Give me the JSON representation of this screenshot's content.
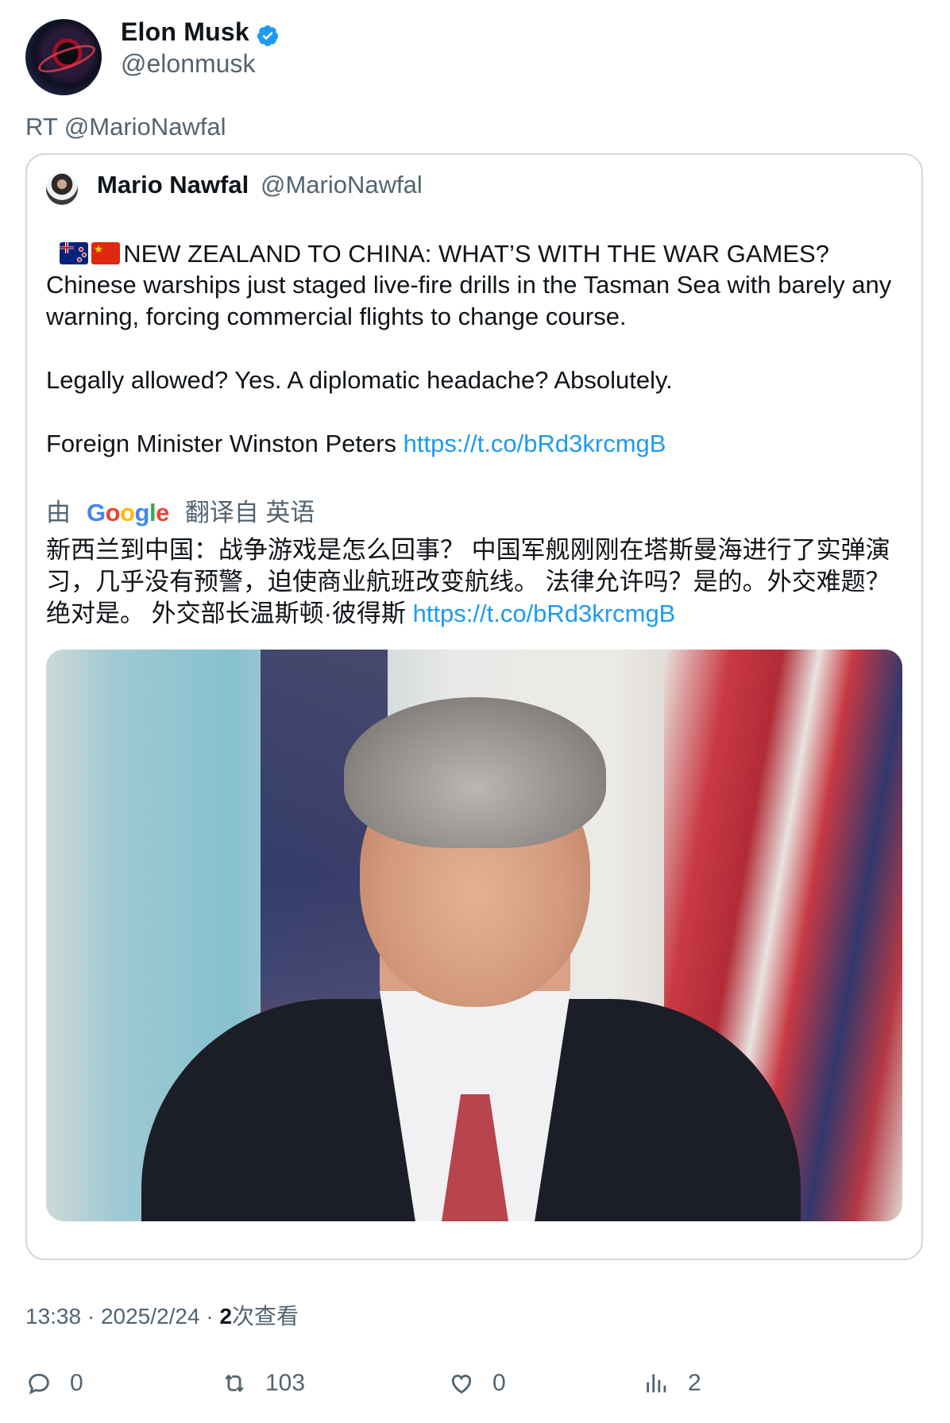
{
  "author": {
    "name": "Elon Musk",
    "handle": "@elonmusk",
    "verified": true
  },
  "retweet_label": "RT @MarioNawfal",
  "quoted": {
    "name": "Mario Nawfal",
    "handle": "@MarioNawfal",
    "headline": "NEW ZEALAND TO CHINA: WHAT’S WITH THE WAR GAMES?",
    "para1": "Chinese warships just staged live-fire drills in the Tasman Sea with barely any warning, forcing commercial flights to change course.",
    "para2": "Legally allowed? Yes. A diplomatic headache? Absolutely.",
    "para3_text": "Foreign Minister Winston Peters ",
    "para3_link": "https://t.co/bRd3krcmgB",
    "translation": {
      "by": "由",
      "google": "Google",
      "from": "翻译自 英语",
      "text": "新西兰到中国：战争游戏是怎么回事？ 中国军舰刚刚在塔斯曼海进行了实弹演习，几乎没有预警，迫使商业航班改变航线。 法律允许吗？是的。外交难题？绝对是。 外交部长温斯顿·彼得斯 ",
      "link": "https://t.co/bRd3krcmgB"
    }
  },
  "meta": {
    "time": "13:38",
    "sep": " · ",
    "date": "2025/2/24",
    "sep2": " · ",
    "views_count": "2",
    "views_label": "次查看"
  },
  "actions": {
    "replies": "0",
    "retweets": "103",
    "likes": "0",
    "views": "2"
  },
  "colors": {
    "link": "#1d9bf0",
    "muted": "#536471",
    "verified": "#1d9bf0"
  }
}
